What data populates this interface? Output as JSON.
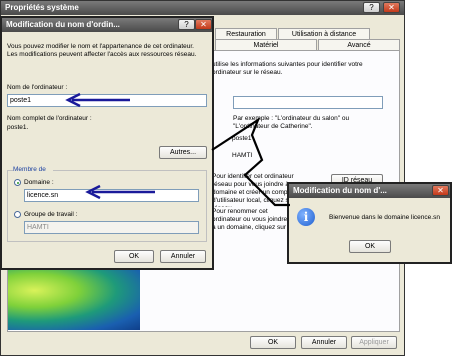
{
  "main_window": {
    "title": "Propriétés système",
    "tabs_row1": [
      "Restauration automatiques",
      "Utilisation à distance"
    ],
    "tabs_row2": [
      "Matériel",
      "Avancé"
    ],
    "intro": "utilise les informations suivantes pour identifier votre ordinateur sur le réseau.",
    "example": "Par exemple : \"L'ordinateur du salon\" ou \"L'ordinateur de Catherine\".",
    "frag_poste": "poste1",
    "frag_hamti": "HAMTI",
    "id_text": "Pour identifier cet ordinateur réseau pour vous joindre à un domaine et créer un compte d'utilisateur local, cliquez sur ID réseau.",
    "rename_text": "Pour renommer cet ordinateur ou vous joindre à un domaine, cliquez sur Modifier.",
    "id_button": "ID réseau",
    "ok": "OK",
    "cancel": "Annuler",
    "apply": "Appliquer"
  },
  "rename_dialog": {
    "title": "Modification du nom d'ordin...",
    "intro": "Vous pouvez modifier le nom et l'appartenance de cet ordinateur. Les modifications peuvent affecter l'accès aux ressources réseau.",
    "computer_name_label": "Nom de l'ordinateur :",
    "computer_name_value": "poste1",
    "full_name_label": "Nom complet de l'ordinateur :",
    "full_name_value": "poste1.",
    "more_button": "Autres...",
    "member_of": "Membre de",
    "domain_label": "Domaine :",
    "domain_value": "licence.sn",
    "workgroup_label": "Groupe de travail :",
    "workgroup_value": "HAMTI",
    "ok": "OK",
    "cancel": "Annuler"
  },
  "welcome_dialog": {
    "title": "Modification du nom d'...",
    "message": "Bienvenue dans le domaine licence.sn",
    "ok": "OK"
  },
  "colors": {
    "arrow": "#1a1a9a",
    "info_icon": "#1f5fcf"
  }
}
